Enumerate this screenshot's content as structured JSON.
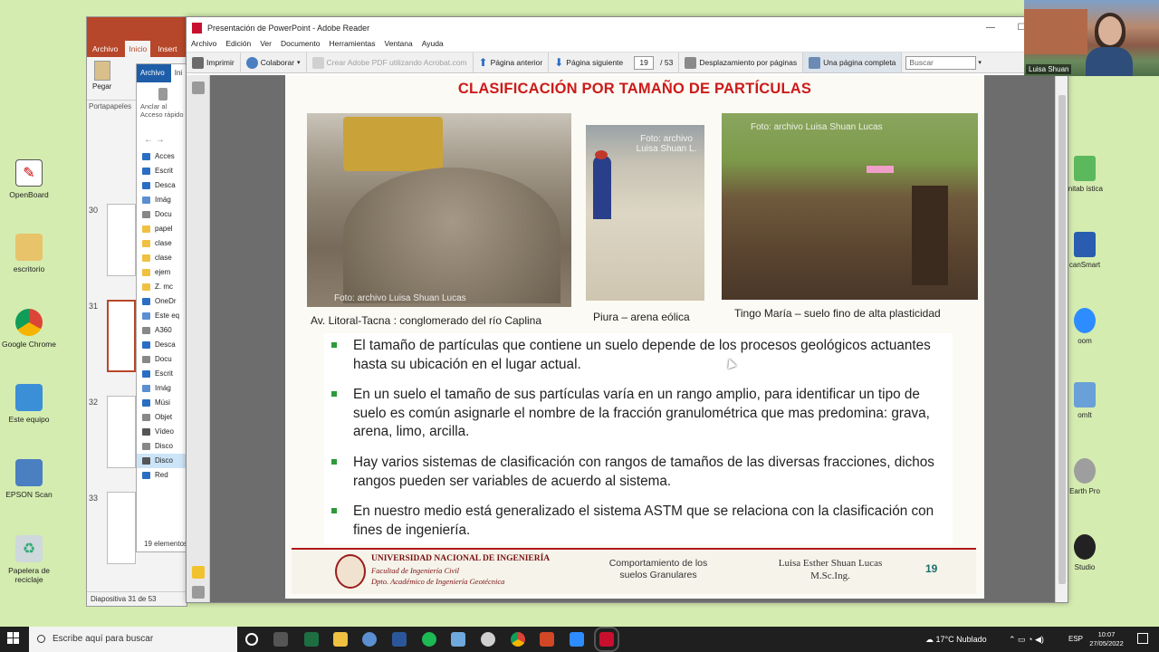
{
  "desktop_icons": [
    {
      "label": "OpenBoard"
    },
    {
      "label": "escritorio"
    },
    {
      "label": "Google Chrome"
    },
    {
      "label": "Este equipo"
    },
    {
      "label": "EPSON Scan"
    },
    {
      "label": "Papelera de reciclaje"
    }
  ],
  "right_icons": [
    {
      "label": "initab ística"
    },
    {
      "label": "canSmart"
    },
    {
      "label": "oom"
    },
    {
      "label": "omIt"
    },
    {
      "label": "Earth Pro"
    },
    {
      "label": "Studio"
    }
  ],
  "powerpoint": {
    "tabs": [
      "Archivo",
      "Inicio",
      "Insert"
    ],
    "ribbon_group": "Portapapeles",
    "paste_label": "Pegar",
    "slide_numbers": [
      "30",
      "31",
      "32",
      "33"
    ],
    "status": "Diapositiva 31 de 53"
  },
  "explorer": {
    "tabs": [
      "Archivo",
      "Ini"
    ],
    "pin_label": "Anclar al Acceso rápido",
    "rows": [
      "Acces",
      "Escrit",
      "Desca",
      "Imág",
      "Docu",
      "papel",
      "clase",
      "clase",
      "ejem",
      "Z. mc",
      "OneDr",
      "Este eq",
      "A360",
      "Desca",
      "Docu",
      "Escrit",
      "Imág",
      "Músi",
      "Objet",
      "Vídeo",
      "Disco",
      "Disco",
      "Red"
    ],
    "count": "19 elementos"
  },
  "reader": {
    "title": "Presentación de PowerPoint - Adobe Reader",
    "menu": [
      "Archivo",
      "Edición",
      "Ver",
      "Documento",
      "Herramientas",
      "Ventana",
      "Ayuda"
    ],
    "toolbar": {
      "print": "Imprimir",
      "collaborate": "Colaborar",
      "create_pdf": "Crear Adobe PDF utilizando Acrobat.com",
      "prev_page": "Página anterior",
      "next_page": "Página siguiente",
      "current_page": "19",
      "total_pages": "/ 53",
      "scroll_mode": "Desplazamiento por páginas",
      "full_page": "Una página completa",
      "search_placeholder": "Buscar"
    }
  },
  "slide": {
    "title": "CLASIFICACIÓN POR TAMAÑO DE PARTÍCULAS",
    "photos": [
      {
        "watermark": "Foto: archivo Luisa Shuan Lucas",
        "caption": "Av. Litoral-Tacna : conglomerado del río Caplina"
      },
      {
        "watermark": "Foto: archivo Luisa Shuan L.",
        "caption": "Piura – arena eólica"
      },
      {
        "watermark": "Foto: archivo Luisa Shuan Lucas",
        "caption": "Tingo María – suelo fino de alta plasticidad"
      }
    ],
    "bullets": [
      "El tamaño de partículas que contiene un suelo depende de los procesos geológicos actuantes hasta su ubicación en el lugar actual.",
      "En un suelo el tamaño de sus partículas varía en un rango amplio, para identificar un tipo de suelo es común asignarle el nombre de la fracción granulométrica que mas predomina: grava, arena, limo, arcilla.",
      "Hay varios sistemas de clasificación con rangos de tamaños de las diversas fracciones, dichos rangos pueden ser variables de acuerdo al sistema.",
      "En nuestro medio está generalizado el sistema ASTM que se relaciona con la clasificación con fines de ingeniería."
    ],
    "footer": {
      "university": "UNIVERSIDAD NACIONAL DE INGENIERÍA",
      "faculty": "Facultad de Ingeniería Civil",
      "department": "Dpto. Académico de Ingeniería Geotécnica",
      "course_line1": "Comportamiento de los",
      "course_line2": "suelos  Granulares",
      "author": "Luisa Esther Shuan Lucas",
      "degree": "M.Sc.Ing.",
      "page": "19"
    }
  },
  "webcam": {
    "name": "Luisa Shuan"
  },
  "taskbar": {
    "search_placeholder": "Escribe aquí para buscar",
    "weather": "17°C  Nublado",
    "lang": "ESP",
    "time": "10:07",
    "date": "27/05/2022"
  }
}
